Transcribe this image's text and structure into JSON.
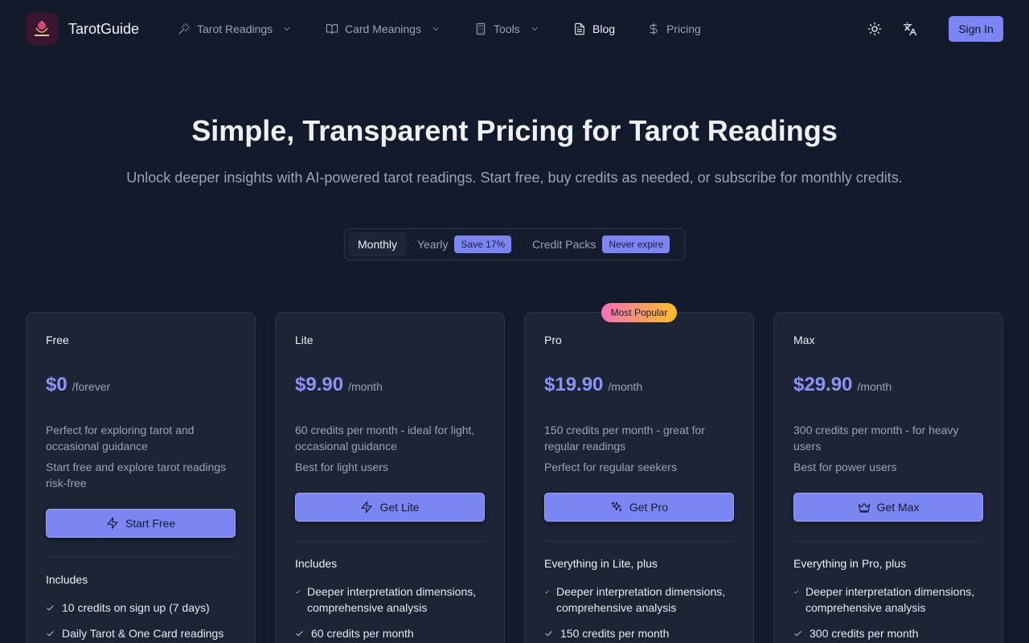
{
  "nav": {
    "brand": "TarotGuide",
    "items": [
      {
        "label": "Tarot Readings",
        "icon": "wand-icon",
        "has_dropdown": true
      },
      {
        "label": "Card Meanings",
        "icon": "book-icon",
        "has_dropdown": true
      },
      {
        "label": "Tools",
        "icon": "calculator-icon",
        "has_dropdown": true
      },
      {
        "label": "Blog",
        "icon": "document-icon",
        "has_dropdown": false,
        "active": true
      },
      {
        "label": "Pricing",
        "icon": "dollar-icon",
        "has_dropdown": false
      }
    ],
    "theme_icon": "sun-icon",
    "language_icon": "translate-icon",
    "sign_in": "Sign In"
  },
  "hero": {
    "title": "Simple, Transparent Pricing for Tarot Readings",
    "subtitle": "Unlock deeper insights with AI-powered tarot readings. Start free, buy credits as needed, or subscribe for monthly credits."
  },
  "billing_toggle": {
    "monthly": "Monthly",
    "yearly": "Yearly",
    "yearly_badge": "Save 17%",
    "credit_packs": "Credit Packs",
    "credit_packs_badge": "Never expire",
    "selected": "Monthly"
  },
  "plans": [
    {
      "name": "Free",
      "price": "$0",
      "period": "/forever",
      "description": "Perfect for exploring tarot and occasional guidance",
      "tagline": "Start free and explore tarot readings risk-free",
      "cta": "Start Free",
      "cta_icon": "zap-icon",
      "includes_label": "Includes",
      "features": [
        "10 credits on sign up (7 days)",
        "Daily Tarot & One Card readings"
      ]
    },
    {
      "name": "Lite",
      "price": "$9.90",
      "period": "/month",
      "description": "60 credits per month - ideal for light, occasional guidance",
      "tagline": "Best for light users",
      "cta": "Get Lite",
      "cta_icon": "zap-icon",
      "includes_label": "Includes",
      "features": [
        "Deeper interpretation dimensions, comprehensive analysis",
        "60 credits per month"
      ]
    },
    {
      "name": "Pro",
      "price": "$19.90",
      "period": "/month",
      "description": "150 credits per month - great for regular readings",
      "tagline": "Perfect for regular seekers",
      "cta": "Get Pro",
      "cta_icon": "sparkles-icon",
      "includes_label": "Everything in Lite, plus",
      "features": [
        "Deeper interpretation dimensions, comprehensive analysis",
        "150 credits per month"
      ],
      "badge": "Most Popular"
    },
    {
      "name": "Max",
      "price": "$29.90",
      "period": "/month",
      "description": "300 credits per month - for heavy users",
      "tagline": "Best for power users",
      "cta": "Get Max",
      "cta_icon": "crown-icon",
      "includes_label": "Everything in Pro, plus",
      "features": [
        "Deeper interpretation dimensions, comprehensive analysis",
        "300 credits per month"
      ]
    }
  ],
  "colors": {
    "background": "#131a2b",
    "card": "#1c2435",
    "accent": "#7c86f2",
    "price": "#8b93f5"
  }
}
